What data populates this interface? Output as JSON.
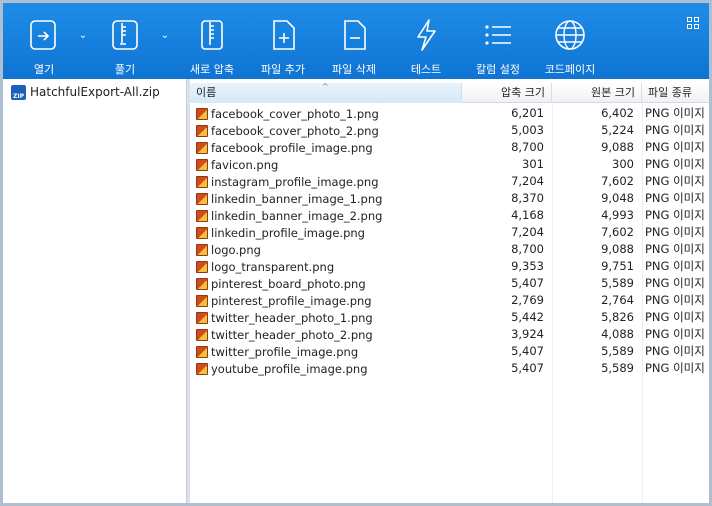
{
  "toolbar": {
    "buttons": [
      {
        "label": "열기",
        "icon": "open-icon"
      },
      {
        "label": "풀기",
        "icon": "extract-icon"
      },
      {
        "label": "새로 압축",
        "icon": "new-archive-icon"
      },
      {
        "label": "파일 추가",
        "icon": "add-file-icon"
      },
      {
        "label": "파일 삭제",
        "icon": "delete-file-icon"
      },
      {
        "label": "테스트",
        "icon": "test-icon"
      },
      {
        "label": "칼럼 설정",
        "icon": "column-settings-icon"
      },
      {
        "label": "코드페이지",
        "icon": "codepage-icon"
      }
    ]
  },
  "tree": {
    "root_label": "HatchfulExport-All.zip"
  },
  "columns": {
    "name": "이름",
    "packed": "압축 크기",
    "original": "원본 크기",
    "type": "파일 종류"
  },
  "files": [
    {
      "name": "facebook_cover_photo_1.png",
      "packed": "6,201",
      "original": "6,402",
      "type": "PNG 이미지"
    },
    {
      "name": "facebook_cover_photo_2.png",
      "packed": "5,003",
      "original": "5,224",
      "type": "PNG 이미지"
    },
    {
      "name": "facebook_profile_image.png",
      "packed": "8,700",
      "original": "9,088",
      "type": "PNG 이미지"
    },
    {
      "name": "favicon.png",
      "packed": "301",
      "original": "300",
      "type": "PNG 이미지"
    },
    {
      "name": "instagram_profile_image.png",
      "packed": "7,204",
      "original": "7,602",
      "type": "PNG 이미지"
    },
    {
      "name": "linkedin_banner_image_1.png",
      "packed": "8,370",
      "original": "9,048",
      "type": "PNG 이미지"
    },
    {
      "name": "linkedin_banner_image_2.png",
      "packed": "4,168",
      "original": "4,993",
      "type": "PNG 이미지"
    },
    {
      "name": "linkedin_profile_image.png",
      "packed": "7,204",
      "original": "7,602",
      "type": "PNG 이미지"
    },
    {
      "name": "logo.png",
      "packed": "8,700",
      "original": "9,088",
      "type": "PNG 이미지"
    },
    {
      "name": "logo_transparent.png",
      "packed": "9,353",
      "original": "9,751",
      "type": "PNG 이미지"
    },
    {
      "name": "pinterest_board_photo.png",
      "packed": "5,407",
      "original": "5,589",
      "type": "PNG 이미지"
    },
    {
      "name": "pinterest_profile_image.png",
      "packed": "2,769",
      "original": "2,764",
      "type": "PNG 이미지"
    },
    {
      "name": "twitter_header_photo_1.png",
      "packed": "5,442",
      "original": "5,826",
      "type": "PNG 이미지"
    },
    {
      "name": "twitter_header_photo_2.png",
      "packed": "3,924",
      "original": "4,088",
      "type": "PNG 이미지"
    },
    {
      "name": "twitter_profile_image.png",
      "packed": "5,407",
      "original": "5,589",
      "type": "PNG 이미지"
    },
    {
      "name": "youtube_profile_image.png",
      "packed": "5,407",
      "original": "5,589",
      "type": "PNG 이미지"
    }
  ],
  "colors": {
    "toolbar": "#1482e0",
    "header_selected": "#dcecf9",
    "frame": "#aebfd2"
  }
}
